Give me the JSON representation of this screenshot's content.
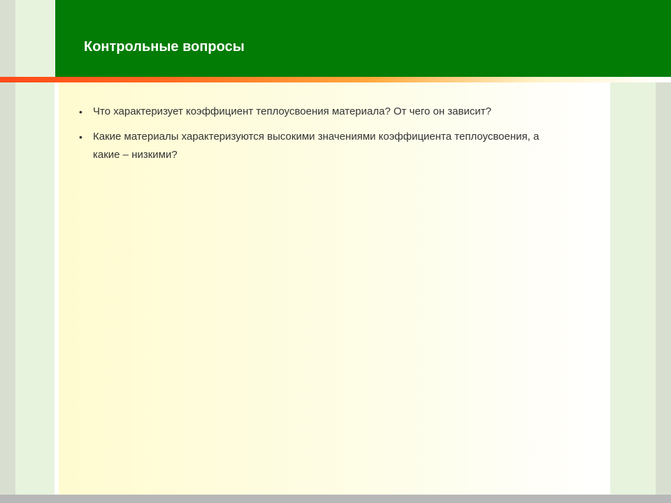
{
  "slide": {
    "title": "Контрольные вопросы",
    "bullets": [
      "Что характеризует коэффициент теплоусвоения материала? От чего он зависит?",
      "Какие материалы характеризуются высокими значениями коэффициента теплоусвоения, а какие – низкими?"
    ]
  },
  "theme": {
    "header_color": "#027c05",
    "accent_color": "#ff4a1a",
    "side_stripe_color": "#e8f3de",
    "content_background": "#fffbd0",
    "bottom_bar_color": "#b8b8b8"
  }
}
